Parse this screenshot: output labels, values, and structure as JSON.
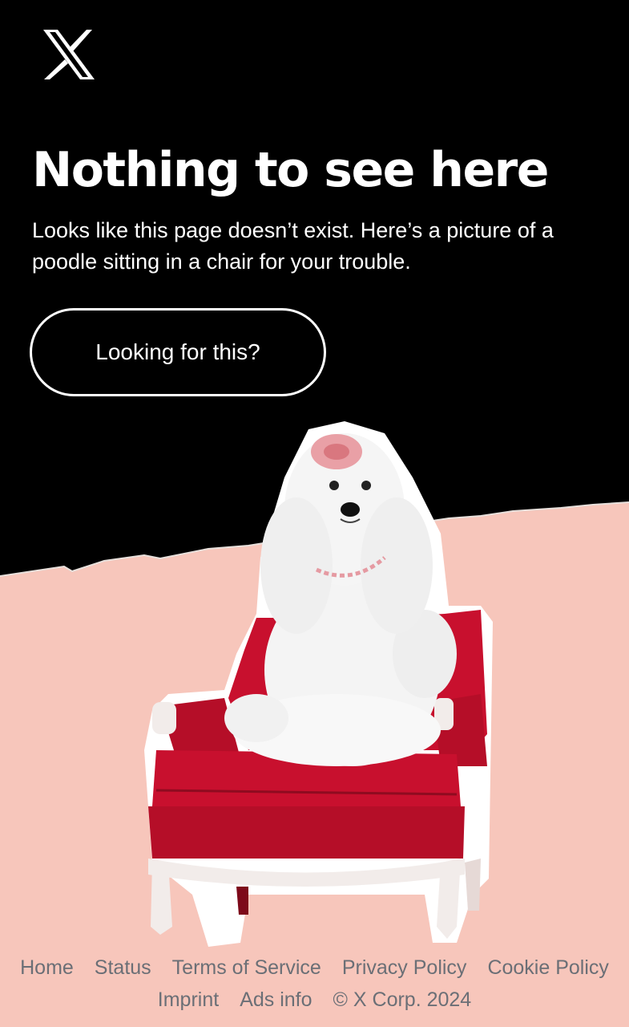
{
  "brand": {
    "logo_icon": "x-logo-icon"
  },
  "main": {
    "title": "Nothing to see here",
    "subtitle": "Looks like this page doesn’t exist. Here’s a picture of a poodle sitting in a chair for your trouble.",
    "cta_label": "Looking for this?"
  },
  "illustration": {
    "icon": "poodle-in-chair-illustration"
  },
  "footer": {
    "row1": [
      "Home",
      "Status",
      "Terms of Service",
      "Privacy Policy",
      "Cookie Policy"
    ],
    "row2": [
      "Imprint",
      "Ads info"
    ],
    "copyright": "© X Corp. 2024"
  },
  "colors": {
    "background": "#000000",
    "pink": "#f7c6bb",
    "chair_red": "#c8102e",
    "footer_text": "#6b6f76",
    "text": "#ffffff"
  }
}
